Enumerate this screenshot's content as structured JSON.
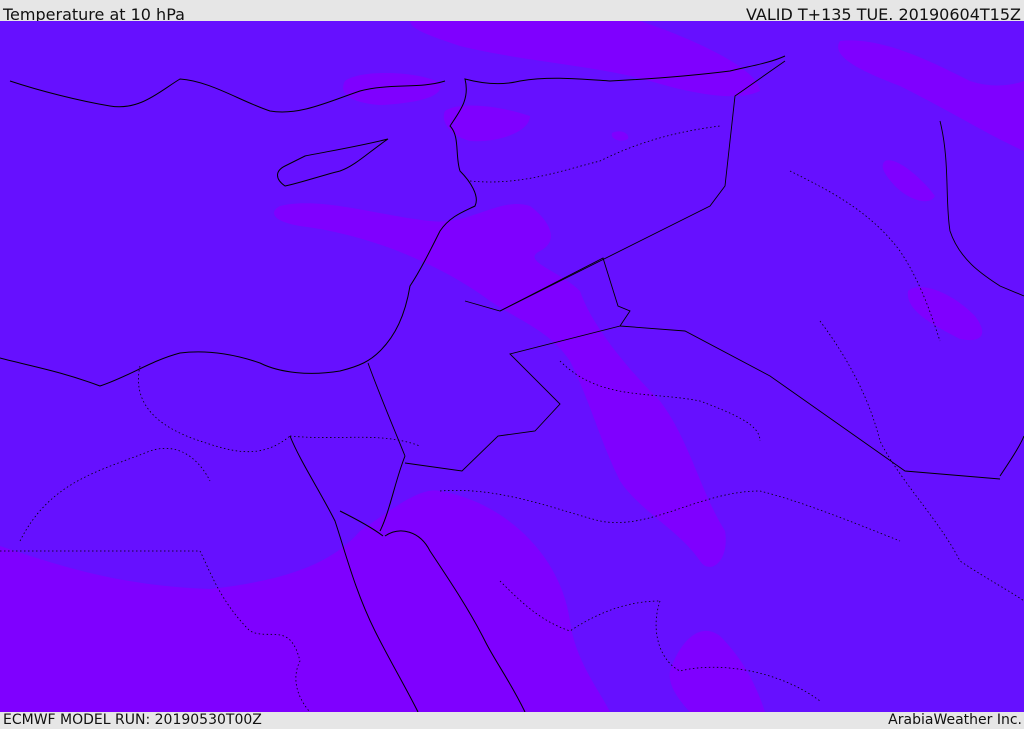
{
  "header": {
    "title": "Temperature at 10 hPa",
    "valid": "VALID T+135 TUE. 20190604T15Z"
  },
  "footer": {
    "model_run": "ECMWF MODEL RUN: 20190530T00Z",
    "credit": "ArabiaWeather Inc."
  },
  "colors": {
    "base": "#6610ff",
    "warm": "#7f00ff",
    "border": "#000000",
    "frame": "#e6e6e6"
  }
}
